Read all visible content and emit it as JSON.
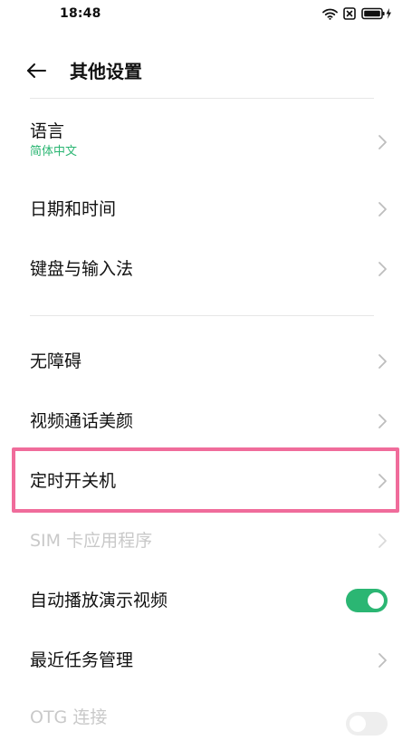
{
  "status_bar": {
    "time": "18:48",
    "icons": [
      "wifi-icon",
      "sim-blocked-icon",
      "battery-charging-icon"
    ]
  },
  "header": {
    "back_icon": "arrow-left-icon",
    "title": "其他设置"
  },
  "settings": {
    "language": {
      "label": "语言",
      "value": "简体中文"
    },
    "date_time": {
      "label": "日期和时间"
    },
    "keyboard": {
      "label": "键盘与输入法"
    },
    "accessibility": {
      "label": "无障碍"
    },
    "video_call_beauty": {
      "label": "视频通话美颜"
    },
    "scheduled_power": {
      "label": "定时开关机"
    },
    "sim_apps": {
      "label": "SIM 卡应用程序",
      "enabled": false
    },
    "autoplay_demo": {
      "label": "自动播放演示视频",
      "toggle_on": true
    },
    "recent_tasks": {
      "label": "最近任务管理"
    },
    "otg": {
      "label": "OTG 连接",
      "enabled": false,
      "toggle_on": false
    }
  },
  "colors": {
    "accent": "#2bb673",
    "highlight": "#f06c9b",
    "disabled_text": "#c9c9c9"
  }
}
